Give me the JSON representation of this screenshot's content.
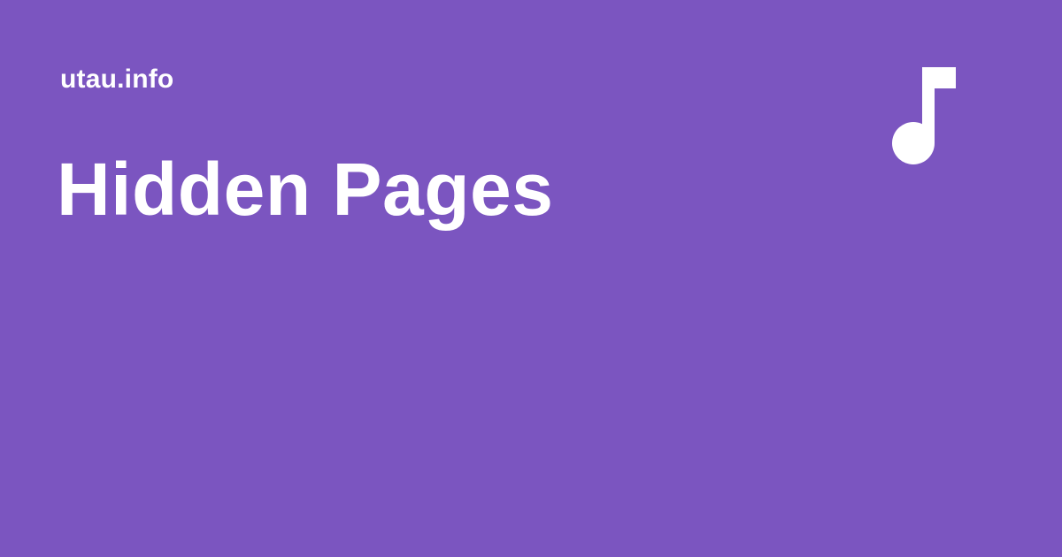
{
  "site": {
    "name": "utau.info"
  },
  "page": {
    "title": "Hidden Pages"
  },
  "icon": {
    "name": "music-note-icon",
    "color": "#ffffff"
  },
  "colors": {
    "background": "#7b55c0",
    "text": "#ffffff"
  }
}
